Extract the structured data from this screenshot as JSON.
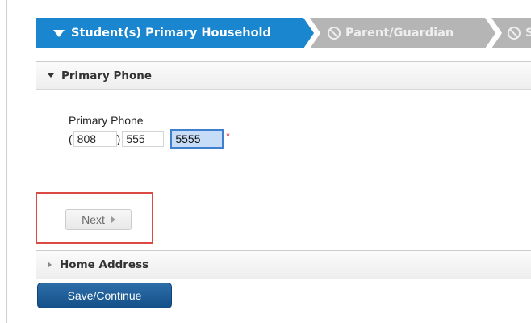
{
  "wizard": {
    "steps": [
      {
        "label": "Student(s) Primary Household",
        "state": "active",
        "color": "#1a86d0"
      },
      {
        "label": "Parent/Guardian",
        "state": "disabled",
        "color": "#b5b5b5"
      },
      {
        "label": "S",
        "state": "disabled",
        "color": "#b5b5b5"
      }
    ]
  },
  "phone_panel": {
    "header": "Primary Phone",
    "field_label": "Primary Phone",
    "open_paren": "(",
    "close_paren": ")",
    "area_code": "808",
    "prefix": "555",
    "line_number": "5555",
    "separator": ".",
    "required_marker": "*",
    "next_label": "Next"
  },
  "address_panel": {
    "header": "Home Address"
  },
  "footer": {
    "save_label": "Save/Continue"
  },
  "colors": {
    "accent": "#1a86d0",
    "save_button": "#1d5d96",
    "highlight": "#dc4b43",
    "required": "#d40000"
  }
}
